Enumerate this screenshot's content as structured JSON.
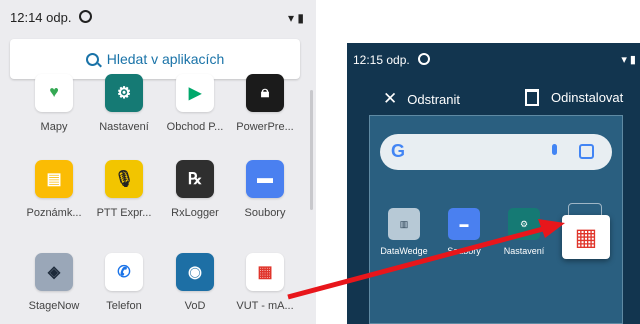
{
  "left_screen": {
    "status_time": "12:14 odp.",
    "search_label": "Hledat v aplikacích",
    "apps": [
      {
        "label": "Mapy",
        "icon": "maps-icon"
      },
      {
        "label": "Nastavení",
        "icon": "settings-icon"
      },
      {
        "label": "Obchod P...",
        "icon": "play-store-icon"
      },
      {
        "label": "PowerPre...",
        "icon": "lock-icon"
      },
      {
        "label": "Poznámk...",
        "icon": "notes-icon"
      },
      {
        "label": "PTT Expr...",
        "icon": "ptt-icon"
      },
      {
        "label": "RxLogger",
        "icon": "rx-icon"
      },
      {
        "label": "Soubory",
        "icon": "folder-icon"
      },
      {
        "label": "StageNow",
        "icon": "stagenow-icon"
      },
      {
        "label": "Telefon",
        "icon": "phone-icon"
      },
      {
        "label": "VoD",
        "icon": "vod-icon"
      },
      {
        "label": "VUT - mA...",
        "icon": "vut-icon"
      }
    ]
  },
  "right_screen": {
    "status_time": "12:15 odp.",
    "remove_label": "Odstranit",
    "uninstall_label": "Odinstalovat",
    "apps": [
      {
        "label": "DataWedge",
        "icon": "datawedge-icon"
      },
      {
        "label": "Soubory",
        "icon": "folder-icon"
      },
      {
        "label": "Nastavení",
        "icon": "settings-icon"
      }
    ],
    "dragged_icon": "vut-icon"
  },
  "colors": {
    "arrow": "#e8161b",
    "home_bg": "#12354f"
  }
}
